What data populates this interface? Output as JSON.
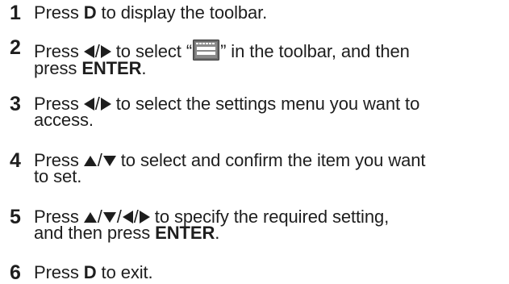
{
  "steps": [
    {
      "number": "1",
      "parts": [
        "Press ",
        "D",
        " to display the toolbar."
      ]
    },
    {
      "number": "2",
      "parts": [
        "Press ",
        " to select “",
        "” in the toolbar, and then",
        "press ",
        "ENTER",
        "."
      ]
    },
    {
      "number": "3",
      "parts": [
        "Press ",
        " to select the settings menu you want to",
        "access."
      ]
    },
    {
      "number": "4",
      "parts": [
        "Press ",
        " to select and confirm the item you want",
        "to set."
      ]
    },
    {
      "number": "5",
      "parts": [
        "Press ",
        " to specify the required setting,",
        "and then press ",
        "ENTER",
        "."
      ]
    },
    {
      "number": "6",
      "parts": [
        "Press ",
        "D",
        " to exit."
      ]
    }
  ],
  "symbols": {
    "slash": "/"
  },
  "icons": {
    "left": "left-triangle-icon",
    "right": "right-triangle-icon",
    "up": "up-triangle-icon",
    "down": "down-triangle-icon",
    "menu": "settings-menu-icon"
  }
}
